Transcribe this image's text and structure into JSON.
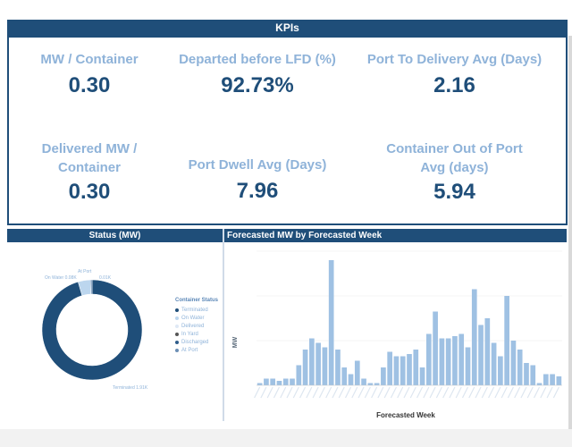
{
  "kpi_section": {
    "title": "KPIs"
  },
  "kpis": [
    {
      "label_lines": [
        "MW / Container"
      ],
      "value": "0.30"
    },
    {
      "label_lines": [
        "Departed before LFD (%)"
      ],
      "value": "92.73%"
    },
    {
      "label_lines": [
        "Port To Delivery Avg (Days)"
      ],
      "value": "2.16"
    },
    {
      "label_lines": [
        "Delivered MW /",
        "Container"
      ],
      "value": "0.30"
    },
    {
      "label_lines": [
        "Port Dwell Avg (Days)"
      ],
      "value": "7.96"
    },
    {
      "label_lines": [
        "Container Out of Port",
        "Avg (days)"
      ],
      "value": "5.94"
    }
  ],
  "status_panel": {
    "title": "Status (MW)",
    "labels": {
      "at_port": "At Port",
      "on_water": "On Water 0.08K",
      "at_port_value": "0.01K",
      "terminated": "Terminated 1.91K"
    },
    "legend_title": "Container Status",
    "legend": [
      {
        "name": "Terminated",
        "color": "#1f4e79"
      },
      {
        "name": "On Water",
        "color": "#bcd6ee"
      },
      {
        "name": "Delivered",
        "color": "#dfe9f5"
      },
      {
        "name": "In Yard",
        "color": "#555555"
      },
      {
        "name": "Discharged",
        "color": "#2e5c8a"
      },
      {
        "name": "At Port",
        "color": "#6c8fb5"
      }
    ]
  },
  "forecast_panel": {
    "title": "Forecasted MW by Forecasted Week",
    "ylabel": "MW",
    "xlabel": "Forecasted Week"
  },
  "chart_data": [
    {
      "type": "pie",
      "title": "Status (MW)",
      "donut": true,
      "categories": [
        "Terminated",
        "On Water",
        "Delivered",
        "In Yard",
        "Discharged",
        "At Port"
      ],
      "values": [
        1.91,
        0.08,
        0.0,
        0.0,
        0.0,
        0.01
      ],
      "colors": [
        "#1f4e79",
        "#bcd6ee",
        "#dfe9f5",
        "#555555",
        "#2e5c8a",
        "#6c8fb5"
      ]
    },
    {
      "type": "bar",
      "title": "Forecasted MW by Forecasted Week",
      "xlabel": "Forecasted Week",
      "ylabel": "MW",
      "ylim": [
        0,
        60
      ],
      "values": [
        1,
        3,
        3,
        2,
        3,
        3,
        9,
        16,
        21,
        19,
        17,
        56,
        16,
        8,
        5,
        11,
        3,
        1,
        1,
        8,
        15,
        13,
        13,
        14,
        16,
        8,
        23,
        33,
        21,
        21,
        22,
        23,
        17,
        43,
        27,
        30,
        19,
        13,
        40,
        20,
        16,
        10,
        9,
        1,
        5,
        5,
        4
      ]
    }
  ]
}
